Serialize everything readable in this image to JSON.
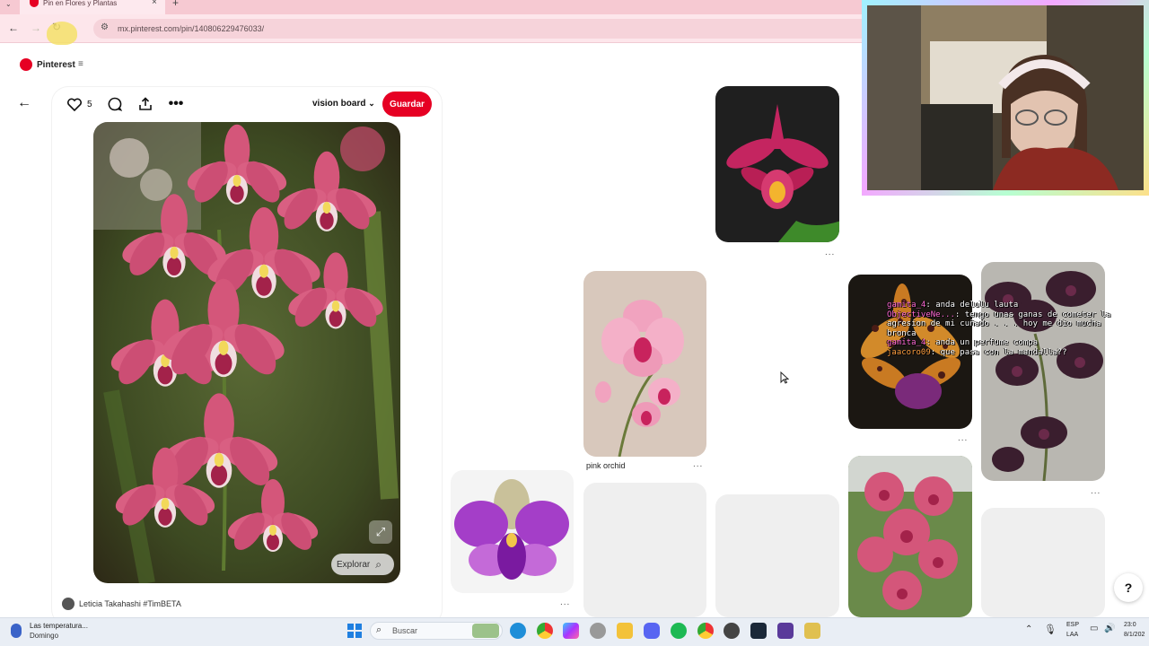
{
  "browser": {
    "tab_title": "Pin en Flores y Plantas",
    "url": "mx.pinterest.com/pin/140806229476033/"
  },
  "pinterest": {
    "brand": "Pinterest",
    "like_count": "5",
    "board_name": "vision board",
    "save_label": "Guardar",
    "explore_label": "Explorar",
    "author": "Leticia Takahashi #TimBETA",
    "related_caption": "pink orchid",
    "more_label": "...",
    "help_label": "?"
  },
  "chat": {
    "lines": [
      {
        "user": "gamita_4",
        "msg": "anda delulu lauta"
      },
      {
        "user": "ObjectiveNe...",
        "msg": "tengo unas ganas de cometer la agresion de mi cuñado . . . hoy me dio mucha bronca"
      },
      {
        "user": "gamita_4",
        "msg": "anda un perfume compa"
      },
      {
        "user": "jaacoro09",
        "msg": "que pasa con la mandalla??"
      }
    ]
  },
  "taskbar": {
    "weather_title": "Las temperatura...",
    "weather_sub": "Domingo",
    "search_placeholder": "Buscar",
    "lang_top": "ESP",
    "lang_bottom": "LAA",
    "clock_time": "23:0",
    "clock_date": "8/1/202"
  },
  "colors": {
    "pinterest_red": "#e60023",
    "tab_pink": "#f6c9d2"
  }
}
